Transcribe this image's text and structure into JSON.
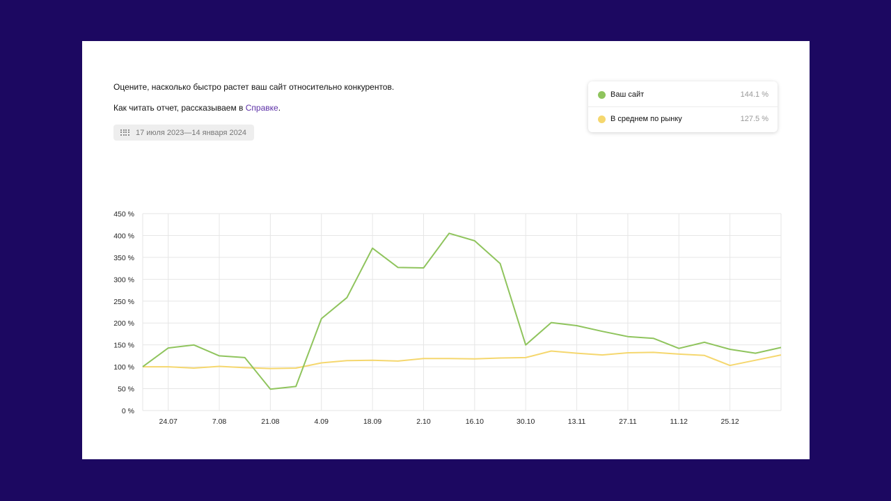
{
  "header": {
    "description": "Оцените, насколько быстро растет ваш сайт относительно конкурентов.",
    "help_prefix": "Как читать отчет, рассказываем в ",
    "help_link": "Справке",
    "help_suffix": ".",
    "date_range": "17 июля 2023—14 января 2024",
    "date_icon": "calendar-grid-icon"
  },
  "legend": [
    {
      "name": "Ваш сайт",
      "value": "144.1 %",
      "color": "#8fc45d"
    },
    {
      "name": "В среднем по рынку",
      "value": "127.5 %",
      "color": "#f5d76e"
    }
  ],
  "colors": {
    "grid": "#e6e6e6",
    "background": "#ffffff",
    "frame": "#1c0861"
  },
  "chart_data": {
    "type": "line",
    "x_labels": [
      "24.07",
      "7.08",
      "21.08",
      "4.09",
      "18.09",
      "2.10",
      "16.10",
      "30.10",
      "13.11",
      "27.11",
      "11.12",
      "25.12"
    ],
    "x_label_indices": [
      1,
      3,
      5,
      7,
      9,
      11,
      13,
      15,
      17,
      19,
      21,
      23
    ],
    "y_ticks": [
      "0 %",
      "50 %",
      "100 %",
      "150 %",
      "200 %",
      "250 %",
      "300 %",
      "350 %",
      "400 %",
      "450 %"
    ],
    "ylim": [
      0,
      450
    ],
    "grid": true,
    "series": [
      {
        "name": "Ваш сайт",
        "color": "#8fc45d",
        "values": [
          100,
          143,
          150,
          125,
          121,
          49,
          55,
          210,
          258,
          371,
          327,
          326,
          405,
          388,
          336,
          150,
          201,
          194,
          181,
          169,
          165,
          142,
          156,
          140,
          131,
          144
        ]
      },
      {
        "name": "В среднем по рынку",
        "color": "#f5d76e",
        "values": [
          100,
          100,
          97,
          101,
          98,
          96,
          97,
          109,
          114,
          115,
          113,
          119,
          119,
          118,
          120,
          121,
          136,
          131,
          127,
          132,
          133,
          129,
          126,
          103,
          115,
          127
        ]
      }
    ]
  }
}
